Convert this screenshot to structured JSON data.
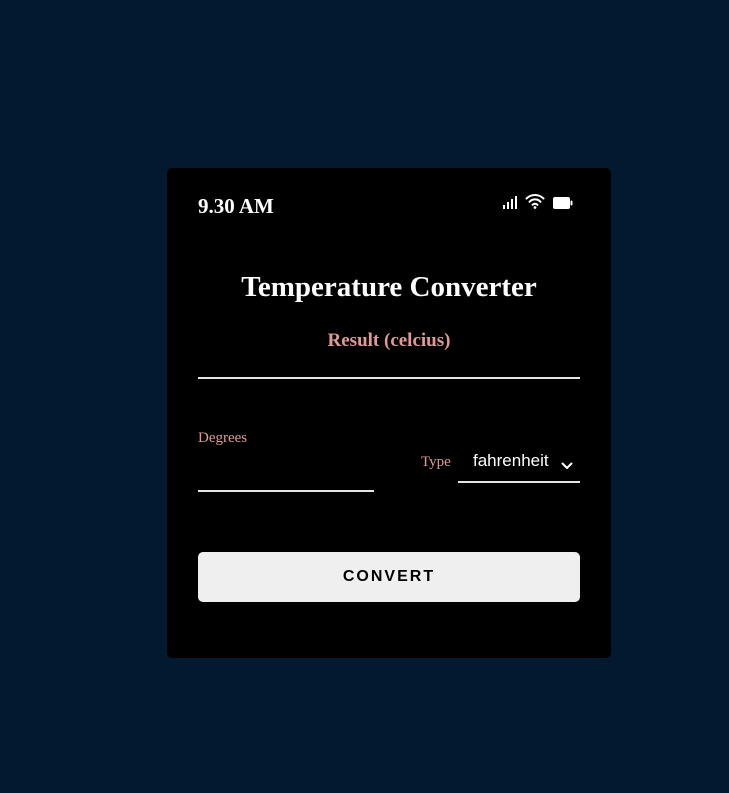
{
  "status_bar": {
    "time": "9.30 AM",
    "icons": [
      "signal-icon",
      "wifi-icon",
      "battery-icon"
    ]
  },
  "app": {
    "title": "Temperature Converter",
    "result_label": "Result (celcius)",
    "result_value": ""
  },
  "form": {
    "degrees_label": "Degrees",
    "degrees_value": "",
    "type_label": "Type",
    "type_selected": "fahrenheit",
    "convert_label": "CONVERT"
  },
  "colors": {
    "page_background": "#011a2f",
    "card_background": "#000000",
    "accent_label": "#e09a96",
    "button_background": "#efefef"
  }
}
